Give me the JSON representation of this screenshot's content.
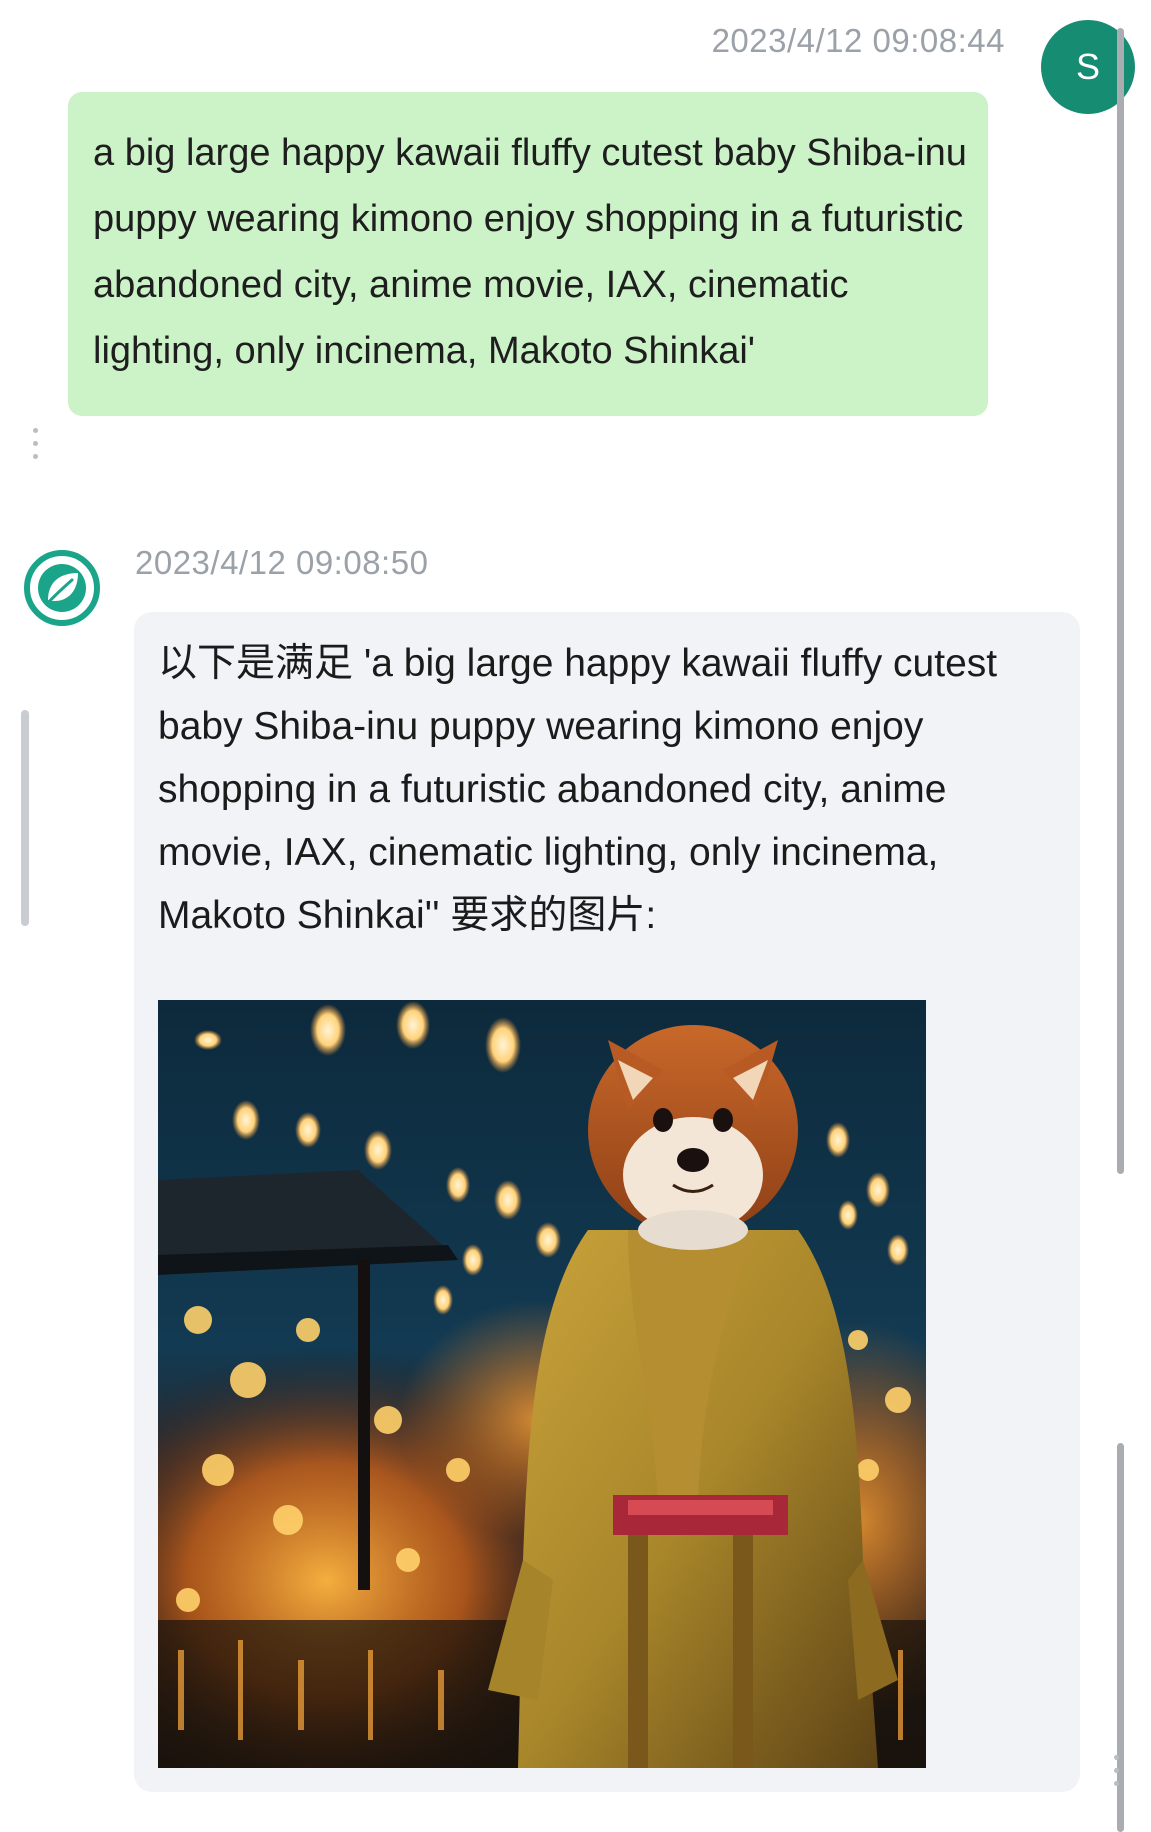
{
  "user_message": {
    "timestamp": "2023/4/12 09:08:44",
    "avatar_letter": "S",
    "text": "a big large happy kawaii fluffy cutest baby Shiba-inu puppy wearing kimono enjoy shopping in a futuristic abandoned city, anime movie, IAX, cinematic lighting, only incinema, Makoto Shinkai'"
  },
  "bot_message": {
    "timestamp": "2023/4/12 09:08:50",
    "avatar_icon": "leaf-icon",
    "text": "以下是满足 'a big large happy kawaii fluffy cutest baby Shiba-inu puppy wearing kimono enjoy shopping in a futuristic abandoned city, anime movie, IAX, cinematic lighting, only incinema, Makoto Shinkai'' 要求的图片:"
  },
  "colors": {
    "user_bubble": "#ccf2c8",
    "user_avatar": "#168c72",
    "bot_bubble": "#f2f3f6",
    "bot_avatar_ring": "#1aa58a",
    "timestamp": "#9ba1a8"
  }
}
